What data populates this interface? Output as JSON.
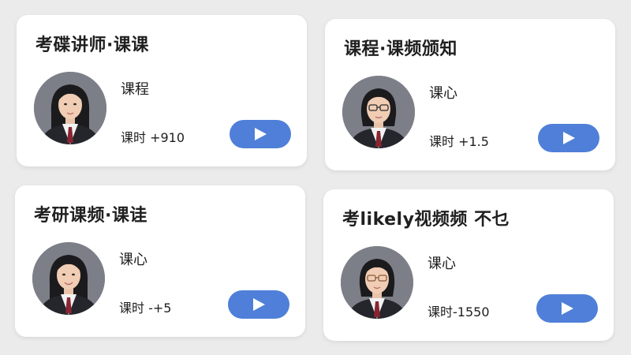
{
  "cards": [
    {
      "title": "考碟讲师·课课",
      "subtitle": "课程",
      "hours": "课时 +910",
      "avatar": "portrait-female",
      "glasses": false
    },
    {
      "title": "课程·课频颁知",
      "subtitle": "课心",
      "hours": "课时 +1.5",
      "avatar": "portrait-female-glasses",
      "glasses": true
    },
    {
      "title": "考研课频·课诖",
      "subtitle": "课心",
      "hours": "课时 -+5",
      "avatar": "portrait-female",
      "glasses": false
    },
    {
      "title": "考likely视频频 不乜",
      "subtitle": "课心",
      "hours": "课时-1550",
      "avatar": "portrait-female-glasses",
      "glasses": true
    }
  ],
  "play_icon": "play-icon",
  "colors": {
    "background": "#ebebeb",
    "card": "#ffffff",
    "button": "#4f7fd8"
  }
}
